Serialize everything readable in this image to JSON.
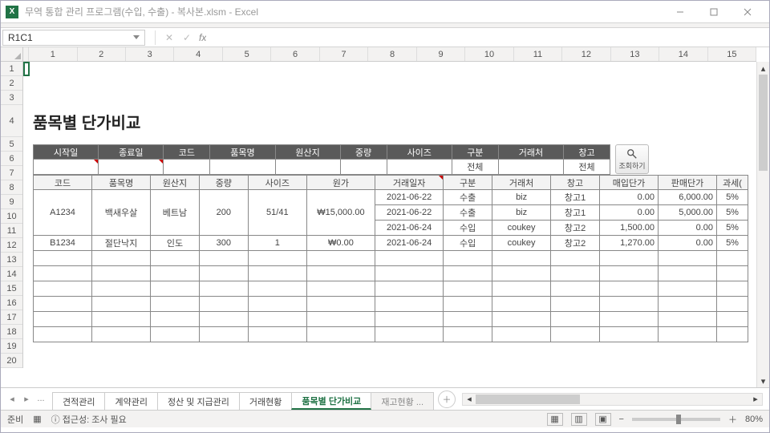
{
  "window": {
    "title": "무역 통합 관리 프로그램(수입, 수출) - 복사본.xlsm - Excel"
  },
  "namebox": {
    "ref": "R1C1"
  },
  "formula_btns": {
    "cancel": "✕",
    "confirm": "✓",
    "fx": "fx"
  },
  "columns": [
    "1",
    "2",
    "3",
    "4",
    "5",
    "6",
    "7",
    "8",
    "9",
    "10",
    "11",
    "12",
    "13",
    "14",
    "15"
  ],
  "rows": [
    "1",
    "2",
    "3",
    "4",
    "5",
    "6",
    "7",
    "8",
    "9",
    "10",
    "11",
    "12",
    "13",
    "14",
    "15",
    "16",
    "17",
    "18",
    "19",
    "20"
  ],
  "report": {
    "title": "품목별 단가비교",
    "filter_headers": [
      "시작일",
      "종료일",
      "코드",
      "품목명",
      "원산지",
      "중량",
      "사이즈",
      "구분",
      "거래처",
      "창고"
    ],
    "filter_values": [
      "",
      "",
      "",
      "",
      "",
      "",
      "",
      "전체",
      "",
      "전체"
    ],
    "search_label": "조회하기",
    "data_headers": [
      "코드",
      "품목명",
      "원산지",
      "중량",
      "사이즈",
      "원가",
      "거래일자",
      "구분",
      "거래처",
      "창고",
      "매입단가",
      "판매단가",
      "과세("
    ],
    "rows": [
      {
        "g": 0,
        "cells": [
          "2021-06-22",
          "수출",
          "biz",
          "창고1",
          "0.00",
          "6,000.00",
          "5%"
        ]
      },
      {
        "g": 0,
        "cells": [
          "2021-06-22",
          "수출",
          "biz",
          "창고1",
          "0.00",
          "5,000.00",
          "5%"
        ]
      },
      {
        "g": 0,
        "cells": [
          "2021-06-24",
          "수입",
          "coukey",
          "창고2",
          "1,500.00",
          "0.00",
          "5%"
        ]
      },
      {
        "g": 1,
        "cells": [
          "2021-06-24",
          "수입",
          "coukey",
          "창고2",
          "1,270.00",
          "0.00",
          "5%"
        ]
      }
    ],
    "groups": [
      {
        "code": "A1234",
        "name": "백새우살",
        "origin": "베트남",
        "weight": "200",
        "size": "51/41",
        "cost": "₩15,000.00"
      },
      {
        "code": "B1234",
        "name": "절단낙지",
        "origin": "인도",
        "weight": "300",
        "size": "1",
        "cost": "₩0.00"
      }
    ]
  },
  "tabs": {
    "items": [
      "견적관리",
      "계약관리",
      "정산 및 지급관리",
      "거래현황",
      "품목별 단가비교",
      "재고현황"
    ],
    "more": "...",
    "active": 4
  },
  "status": {
    "ready": "준비",
    "accessibility": "접근성: 조사 필요",
    "zoom": "80%"
  }
}
